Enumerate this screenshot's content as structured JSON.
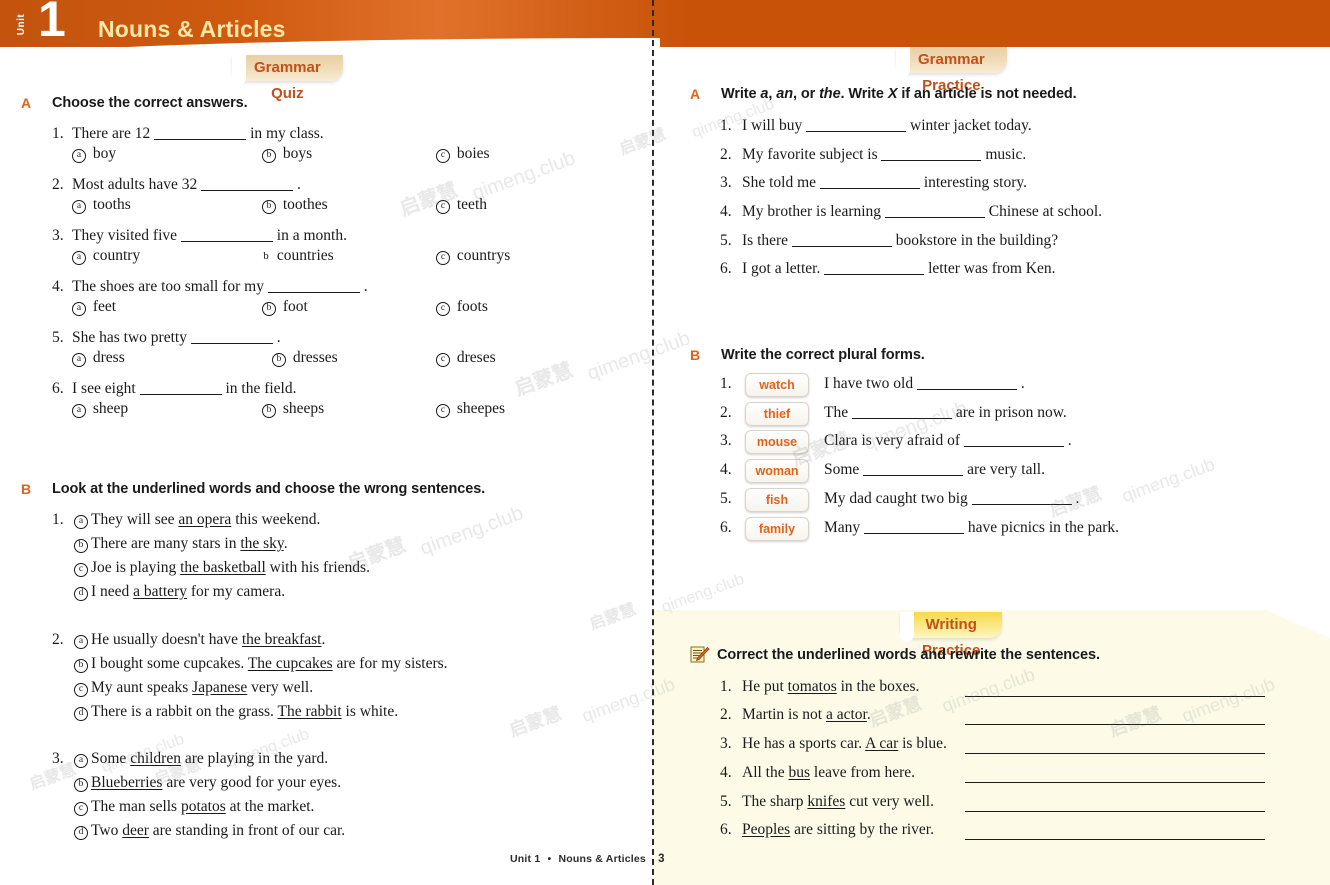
{
  "header": {
    "unit_label": "Unit",
    "unit_number": "1",
    "title": "Nouns & Articles",
    "bg_color": "#c85208",
    "title_color": "#f7e8a8"
  },
  "tabs": {
    "grammar_quiz": "Grammar Quiz",
    "grammar_practice": "Grammar Practice",
    "writing_practice": "Writing Practice",
    "tab_text_color": "#c2501a"
  },
  "left_page": {
    "section_a": {
      "letter": "A",
      "title": "Choose the correct answers.",
      "questions": [
        {
          "num": "1.",
          "pre": "There are 12",
          "post": "in my class.",
          "options": [
            {
              "mark": "a",
              "text": "boy"
            },
            {
              "mark": "b",
              "text": "boys"
            },
            {
              "mark": "c",
              "text": "boies"
            }
          ]
        },
        {
          "num": "2.",
          "pre": "Most adults have 32",
          "post": ".",
          "options": [
            {
              "mark": "a",
              "text": "tooths"
            },
            {
              "mark": "b",
              "text": "toothes"
            },
            {
              "mark": "c",
              "text": "teeth"
            }
          ]
        },
        {
          "num": "3.",
          "pre": "They visited five",
          "post": "in a month.",
          "options": [
            {
              "mark": "a",
              "text": "country"
            },
            {
              "mark": "b",
              "text": "countries"
            },
            {
              "mark": "c",
              "text": "countrys"
            }
          ]
        },
        {
          "num": "4.",
          "pre": "The shoes are too small for my",
          "post": ".",
          "options": [
            {
              "mark": "a",
              "text": "feet"
            },
            {
              "mark": "b",
              "text": "foot"
            },
            {
              "mark": "c",
              "text": "foots"
            }
          ]
        },
        {
          "num": "5.",
          "pre": "She has two pretty",
          "post": ".",
          "options": [
            {
              "mark": "a",
              "text": "dress"
            },
            {
              "mark": "b",
              "text": "dresses"
            },
            {
              "mark": "c",
              "text": "dreses"
            }
          ]
        },
        {
          "num": "6.",
          "pre": "I see eight",
          "post": "in the field.",
          "options": [
            {
              "mark": "a",
              "text": "sheep"
            },
            {
              "mark": "b",
              "text": "sheeps"
            },
            {
              "mark": "c",
              "text": "sheepes"
            }
          ]
        }
      ]
    },
    "section_b": {
      "letter": "B",
      "title": "Look at the underlined words and choose the wrong sentences.",
      "questions": [
        {
          "num": "1.",
          "choices": [
            {
              "mark": "a",
              "before": "They will see ",
              "underlined": "an opera",
              "after": " this weekend."
            },
            {
              "mark": "b",
              "before": "There are many stars in ",
              "underlined": "the sky",
              "after": "."
            },
            {
              "mark": "c",
              "before": "Joe is playing ",
              "underlined": "the basketball",
              "after": " with his friends."
            },
            {
              "mark": "d",
              "before": "I need ",
              "underlined": "a battery",
              "after": " for my camera."
            }
          ]
        },
        {
          "num": "2.",
          "choices": [
            {
              "mark": "a",
              "before": "He usually doesn't have ",
              "underlined": "the breakfast",
              "after": "."
            },
            {
              "mark": "b",
              "before": "I bought some cupcakes. ",
              "underlined": "The cupcakes",
              "after": " are for my sisters."
            },
            {
              "mark": "c",
              "before": "My aunt speaks ",
              "underlined": "Japanese",
              "after": " very well."
            },
            {
              "mark": "d",
              "before": "There is a rabbit on the grass. ",
              "underlined": "The rabbit",
              "after": " is white."
            }
          ]
        },
        {
          "num": "3.",
          "choices": [
            {
              "mark": "a",
              "before": "Some ",
              "underlined": "children",
              "after": " are playing in the yard."
            },
            {
              "mark": "b",
              "before": "",
              "underlined": "Blueberries",
              "after": " are very good for your eyes."
            },
            {
              "mark": "c",
              "before": "The man sells ",
              "underlined": "potatos",
              "after": " at the market."
            },
            {
              "mark": "d",
              "before": "Two ",
              "underlined": "deer",
              "after": " are standing in front of our car."
            }
          ]
        }
      ]
    },
    "footer": {
      "unit": "Unit 1",
      "sep": "•",
      "title": "Nouns & Articles",
      "page": "3"
    }
  },
  "right_page": {
    "section_a": {
      "letter": "A",
      "title_parts": [
        {
          "text": "Write ",
          "style": "normal"
        },
        {
          "text": "a",
          "style": "italic"
        },
        {
          "text": ", ",
          "style": "normal"
        },
        {
          "text": "an",
          "style": "italic"
        },
        {
          "text": ", or ",
          "style": "normal"
        },
        {
          "text": "the",
          "style": "italic"
        },
        {
          "text": ". Write ",
          "style": "normal"
        },
        {
          "text": "X",
          "style": "italic"
        },
        {
          "text": " if an article is not needed.",
          "style": "normal"
        }
      ],
      "questions": [
        {
          "num": "1.",
          "pre": "I will buy",
          "post": "winter jacket today."
        },
        {
          "num": "2.",
          "pre": "My favorite subject is",
          "post": "music."
        },
        {
          "num": "3.",
          "pre": "She told me",
          "post": "interesting story."
        },
        {
          "num": "4.",
          "pre": "My brother is learning",
          "post": "Chinese at school."
        },
        {
          "num": "5.",
          "pre": "Is there",
          "post": "bookstore in the building?"
        },
        {
          "num": "6.",
          "pre": "I got a letter.",
          "post": "letter was from Ken."
        }
      ]
    },
    "section_b": {
      "letter": "B",
      "title": "Write the correct plural forms.",
      "questions": [
        {
          "num": "1.",
          "word": "watch",
          "pre": "I have two old",
          "post": "."
        },
        {
          "num": "2.",
          "word": "thief",
          "pre": "The",
          "post": "are in prison now."
        },
        {
          "num": "3.",
          "word": "mouse",
          "pre": "Clara is very afraid of",
          "post": "."
        },
        {
          "num": "4.",
          "word": "woman",
          "pre": "Some",
          "post": "are very tall."
        },
        {
          "num": "5.",
          "word": "fish",
          "pre": "My dad caught two big",
          "post": "."
        },
        {
          "num": "6.",
          "word": "family",
          "pre": "Many",
          "post": "have picnics in the park."
        }
      ]
    },
    "writing": {
      "icon": "notepad-pencil-icon",
      "title": "Correct the underlined words and rewrite the sentences.",
      "bg_color": "#fdfbe8",
      "questions": [
        {
          "num": "1.",
          "before": "He put ",
          "underlined": "tomatos",
          "after": " in the boxes."
        },
        {
          "num": "2.",
          "before": "Martin is not ",
          "underlined": "a actor",
          "after": "."
        },
        {
          "num": "3.",
          "before": "He has a sports car. ",
          "underlined": "A car",
          "after": " is blue."
        },
        {
          "num": "4.",
          "before": "All the ",
          "underlined": "bus",
          "after": " leave from here."
        },
        {
          "num": "5.",
          "before": "The sharp ",
          "underlined": "knifes",
          "after": " cut very well."
        },
        {
          "num": "6.",
          "before": "",
          "underlined": "Peoples",
          "after": " are sitting by the river."
        }
      ]
    }
  },
  "watermarks": {
    "latin": "qimeng.club",
    "cjk": "启蒙慧"
  }
}
